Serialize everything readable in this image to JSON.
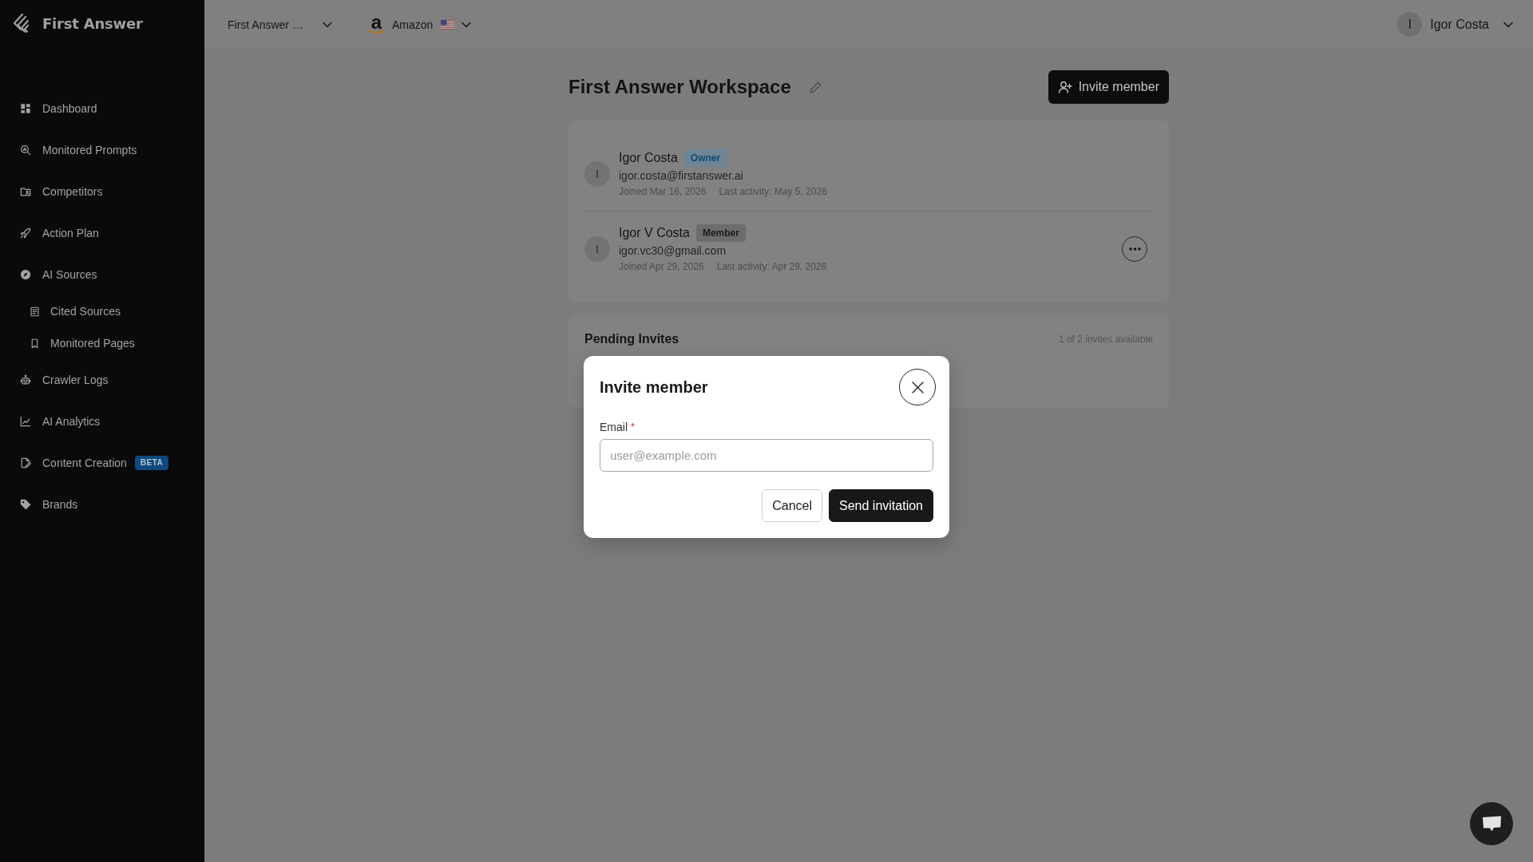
{
  "sidebar": {
    "brand": "First Answer",
    "nav": [
      {
        "label": "Dashboard"
      },
      {
        "label": "Monitored Prompts"
      },
      {
        "label": "Competitors"
      },
      {
        "label": "Action Plan"
      },
      {
        "label": "AI Sources",
        "children": [
          {
            "label": "Cited Sources"
          },
          {
            "label": "Monitored Pages"
          }
        ]
      },
      {
        "label": "Crawler Logs"
      },
      {
        "label": "AI Analytics"
      },
      {
        "label": "Content Creation",
        "badge": "BETA"
      },
      {
        "label": "Brands"
      }
    ]
  },
  "topbar": {
    "workspace_selector": "First Answer …",
    "store_selector": {
      "logo": "a",
      "label": "Amazon"
    },
    "user_menu": {
      "initial": "I",
      "name": "Igor Costa"
    }
  },
  "workspace": {
    "title": "First Answer Workspace",
    "invite_button": "Invite member",
    "members": [
      {
        "kind": "owner",
        "initial": "I",
        "name": "Igor Costa",
        "role": "Owner",
        "email": "igor.costa@firstanswer.ai",
        "joined": "Joined Mar 16, 2026",
        "last_activity": "Last activity: May 5, 2026"
      },
      {
        "kind": "member",
        "initial": "I",
        "name": "Igor V Costa",
        "role": "Member",
        "email": "igor.vc30@gmail.com",
        "joined": "Joined Apr 29, 2026",
        "last_activity": "Last activity: Apr 29, 2026"
      }
    ],
    "pending_invites": {
      "title": "Pending Invites",
      "availability": "1 of 2 invites available"
    }
  },
  "invite_dialog": {
    "title": "Invite member",
    "email_field": {
      "label": "Email",
      "required_mark": "*",
      "placeholder": "user@example.com"
    },
    "buttons": {
      "cancel": "Cancel",
      "submit": "Send invitation"
    }
  }
}
